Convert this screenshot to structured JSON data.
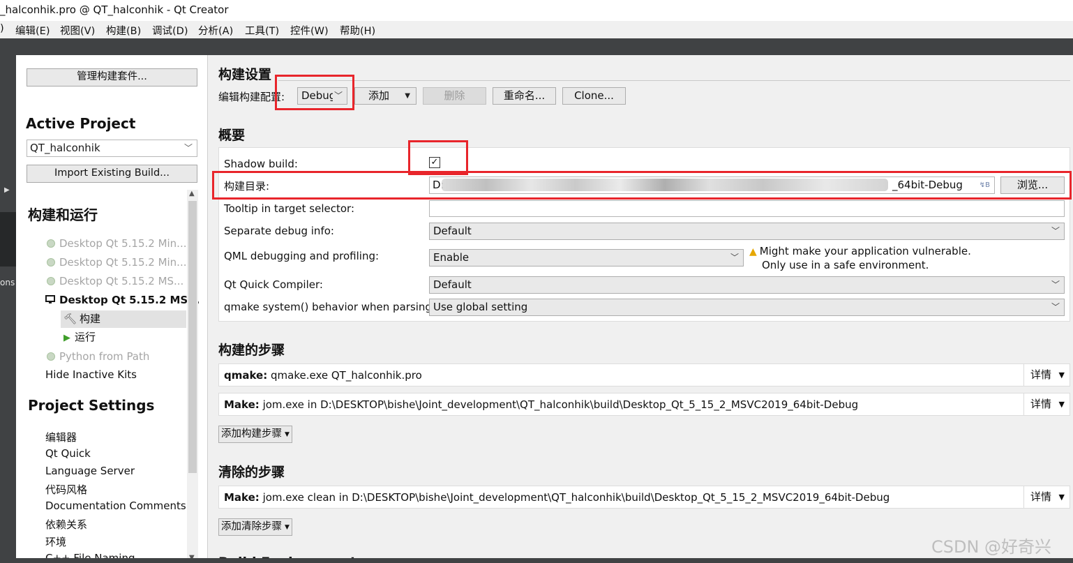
{
  "window": {
    "title": "_halconhik.pro @ QT_halconhik - Qt Creator"
  },
  "menu": [
    "编辑(E)",
    "视图(V)",
    "构建(B)",
    "调试(D)",
    "分析(A)",
    "工具(T)",
    "控件(W)",
    "帮助(H)"
  ],
  "modebar": {
    "partial_label": "ons",
    "partial_menu": ")"
  },
  "sidebar": {
    "manage_kits_button": "管理构建套件...",
    "active_project_heading": "Active Project",
    "project_combo": "QT_halconhik",
    "import_button": "Import Existing Build...",
    "build_run_heading": "构建和运行",
    "kits": [
      "Desktop Qt 5.15.2 Min...",
      "Desktop Qt 5.15.2 Min...",
      "Desktop Qt 5.15.2 MS...",
      "Desktop Qt 5.15.2 MS..."
    ],
    "build_item": "构建",
    "run_item": "运行",
    "python_kit": "Python from Path",
    "hide_inactive": "Hide Inactive Kits",
    "project_settings_heading": "Project Settings",
    "settings_items": [
      "编辑器",
      "Qt Quick",
      "Language Server",
      "代码风格",
      "Documentation Comments",
      "依赖关系",
      "环境",
      "C++ File Naming"
    ]
  },
  "build_settings": {
    "heading": "构建设置",
    "edit_config_label": "编辑构建配置:",
    "config_value": "Debug",
    "add_button": "添加",
    "delete_button": "删除",
    "rename_button": "重命名...",
    "clone_button": "Clone..."
  },
  "general": {
    "heading": "概要",
    "shadow_build_label": "Shadow build:",
    "shadow_build_checked": true,
    "build_dir_label": "构建目录:",
    "build_dir_prefix": "D:",
    "build_dir_suffix": "_64bit-Debug",
    "browse_button": "浏览...",
    "tooltip_label": "Tooltip in target selector:",
    "tooltip_value": "",
    "sep_debug_label": "Separate debug info:",
    "sep_debug_value": "Default",
    "qml_label": "QML debugging and profiling:",
    "qml_value": "Enable",
    "warning_line1": "Might make your application vulnerable.",
    "warning_line2": "Only use in a safe environment.",
    "quick_compiler_label": "Qt Quick Compiler:",
    "quick_compiler_value": "Default",
    "qmake_system_label": "qmake system() behavior when parsing:",
    "qmake_system_value": "Use global setting"
  },
  "build_steps": {
    "heading": "构建的步骤",
    "steps": [
      {
        "name": "qmake:",
        "text": "qmake.exe QT_halconhik.pro",
        "details": "详情"
      },
      {
        "name": "Make:",
        "text": "jom.exe in D:\\DESKTOP\\bishe\\Joint_development\\QT_halconhik\\build\\Desktop_Qt_5_15_2_MSVC2019_64bit-Debug",
        "details": "详情"
      }
    ],
    "add_button": "添加构建步骤"
  },
  "clean_steps": {
    "heading": "清除的步骤",
    "steps": [
      {
        "name": "Make:",
        "text": "jom.exe clean in D:\\DESKTOP\\bishe\\Joint_development\\QT_halconhik\\build\\Desktop_Qt_5_15_2_MSVC2019_64bit-Debug",
        "details": "详情"
      }
    ],
    "add_button": "添加清除步骤"
  },
  "next_heading_partial": "Build Environment",
  "watermark": "CSDN @好奇兴",
  "colors": {
    "highlight_red": "#e8252b",
    "dark_chrome": "#404244",
    "warning_yellow": "#e6a700"
  }
}
